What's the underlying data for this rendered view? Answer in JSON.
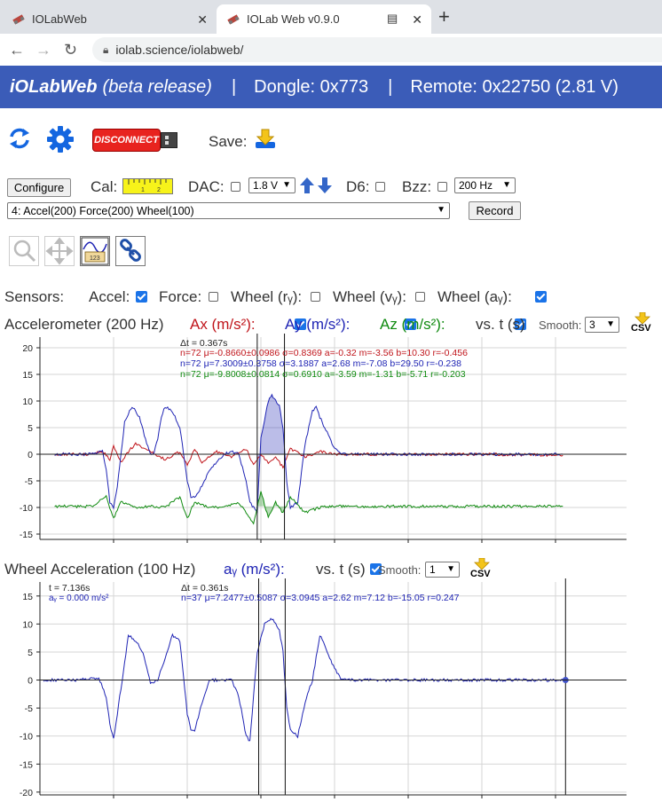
{
  "browser": {
    "tabs": [
      {
        "title": "IOLabWeb",
        "active": false
      },
      {
        "title": "IOLab Web v0.9.0",
        "active": true
      }
    ],
    "url": "iolab.science/iolabweb/"
  },
  "banner": {
    "app_name": "iOLabWeb",
    "release": "(beta release)",
    "dongle": "Dongle: 0x773",
    "remote": "Remote: 0x22750 (2.81 V)",
    "separator": "|",
    "color": "#3b5cb8"
  },
  "toolbar": {
    "disconnect_label": "DISCONNECT",
    "save_label": "Save:"
  },
  "controls": {
    "configure_label": "Configure",
    "cal_label": "Cal:",
    "dac_label": "DAC:",
    "dac_value": "1.8 V",
    "d6_label": "D6:",
    "bzz_label": "Bzz:",
    "rate_value": "200 Hz",
    "config_value": "4: Accel(200) Force(200) Wheel(100)",
    "record_label": "Record"
  },
  "sensors": {
    "label": "Sensors:",
    "items": [
      {
        "label": "Accel:",
        "checked": true
      },
      {
        "label": "Force:",
        "checked": false
      },
      {
        "label": "Wheel (rᵧ):",
        "checked": false
      },
      {
        "label": "Wheel (vᵧ):",
        "checked": false
      },
      {
        "label": "Wheel (aᵧ):",
        "checked": true
      }
    ]
  },
  "accel_panel": {
    "title": "Accelerometer (200 Hz)",
    "ax_label": "Ax (m/s²):",
    "ay_label": "Ay (m/s²):",
    "az_label": "Az (m/s²):",
    "vs_label": "vs. t (s)",
    "smooth_label": "Smooth:",
    "smooth_value": "3",
    "csv_label": "CSV",
    "dt": "Δt = 0.367s",
    "stats_ax": "n=72 μ=-0.8660±0.0986 σ=0.8369 a=-0.32 m=-3.56 b=10.30 r=-0.456",
    "stats_ay": "n=72 μ=7.3009±0.3758 σ=3.1887 a=2.68 m=-7.08 b=29.50 r=-0.238",
    "stats_az": "n=72 μ=-9.8008±0.0814 σ=0.6910 a=-3.59 m=-1.31 b=-5.71 r=-0.203",
    "colors": {
      "ax": "#c0151b",
      "ay": "#1f24b4",
      "az": "#0f8a0f"
    }
  },
  "wheel_panel": {
    "title": "Wheel Acceleration (100 Hz)",
    "ay_label": "aᵧ (m/s²):",
    "vs_label": "vs. t (s)",
    "smooth_label": "Smooth:",
    "smooth_value": "1",
    "csv_label": "CSV",
    "t_readout": "t = 7.136s",
    "ay_readout": "aᵧ = 0.000 m/s²",
    "dt": "Δt = 0.361s",
    "stats": "n=37 μ=7.2477±0.5087 σ=3.0945 a=2.62 m=7.12 b=-15.05 r=0.247"
  },
  "chart_data": [
    {
      "type": "line",
      "title": "Accelerometer (200 Hz)",
      "xlabel": "t (s)",
      "ylabel": "",
      "xlim": [
        0,
        8
      ],
      "ylim": [
        -16,
        22
      ],
      "xticks": [
        1,
        2,
        3,
        4,
        5,
        6,
        7
      ],
      "yticks": [
        -15,
        -10,
        -5,
        0,
        5,
        10,
        15,
        20
      ],
      "grid": true,
      "selection": [
        2.95,
        3.32
      ],
      "series": [
        {
          "name": "Ax (m/s²)",
          "color": "#c0151b",
          "x": [
            0.2,
            0.7,
            0.85,
            0.95,
            1.0,
            1.1,
            1.2,
            1.3,
            1.5,
            1.7,
            1.9,
            2.0,
            2.1,
            2.2,
            2.4,
            2.6,
            2.8,
            2.9,
            3.0,
            3.1,
            3.2,
            3.3,
            3.4,
            3.6,
            3.8,
            4.0,
            4.3,
            5.0,
            6.0,
            7.1
          ],
          "y": [
            0,
            0,
            0.5,
            -1,
            1.5,
            -1.5,
            0.5,
            2,
            0.5,
            -1,
            0.5,
            -2,
            1,
            -1.5,
            0.5,
            -0.5,
            1,
            -2,
            0,
            -1.5,
            -0.5,
            -2.5,
            1,
            -0.5,
            0.5,
            0,
            0,
            0,
            0,
            -0.2
          ]
        },
        {
          "name": "Ay (m/s²)",
          "color": "#1f24b4",
          "x": [
            0.2,
            0.7,
            0.85,
            0.9,
            0.95,
            1.0,
            1.05,
            1.1,
            1.15,
            1.25,
            1.35,
            1.45,
            1.5,
            1.55,
            1.6,
            1.65,
            1.7,
            1.8,
            1.9,
            2.0,
            2.05,
            2.1,
            2.2,
            2.3,
            2.5,
            2.6,
            2.7,
            2.8,
            2.85,
            2.95,
            3.0,
            3.1,
            3.15,
            3.25,
            3.3,
            3.35,
            3.4,
            3.5,
            3.6,
            3.7,
            3.75,
            3.8,
            3.9,
            4.0,
            4.1,
            4.2,
            4.3,
            4.5,
            5.0,
            6.0,
            7.1
          ],
          "y": [
            0,
            0,
            0.5,
            -3,
            -9,
            -10,
            -6,
            0,
            6,
            9,
            7,
            2,
            0,
            0.5,
            3,
            7,
            9,
            8,
            5,
            -5,
            -8,
            -8,
            -6,
            -3,
            0,
            0.5,
            0,
            -5,
            -9,
            -11,
            3,
            10,
            11,
            9,
            5,
            -5,
            -10,
            -9,
            2,
            8,
            9,
            7,
            4,
            1,
            0,
            0,
            0,
            0,
            0,
            0,
            0
          ]
        },
        {
          "name": "Az (m/s²)",
          "color": "#0f8a0f",
          "x": [
            0.2,
            0.7,
            0.9,
            1.0,
            1.1,
            1.3,
            1.5,
            1.7,
            1.9,
            2.0,
            2.1,
            2.3,
            2.5,
            2.7,
            2.9,
            3.0,
            3.1,
            3.2,
            3.3,
            3.4,
            3.6,
            3.8,
            4.0,
            4.5,
            5.0,
            6.0,
            7.1
          ],
          "y": [
            -9.8,
            -9.8,
            -8,
            -12,
            -9,
            -10,
            -9.8,
            -10,
            -8,
            -12,
            -9,
            -10,
            -10,
            -9,
            -13,
            -7,
            -12,
            -9,
            -11,
            -8,
            -11,
            -10,
            -9.8,
            -9.8,
            -9.8,
            -9.8,
            -9.8
          ]
        }
      ]
    },
    {
      "type": "line",
      "title": "Wheel Acceleration (100 Hz)",
      "xlabel": "t (s)",
      "ylabel": "",
      "xlim": [
        0,
        8
      ],
      "ylim": [
        -20.5,
        17.5
      ],
      "xticks": [
        1,
        2,
        3,
        4,
        5,
        6,
        7
      ],
      "yticks": [
        -20,
        -15,
        -10,
        -5,
        0,
        5,
        10,
        15
      ],
      "grid": true,
      "selection": [
        2.97,
        3.33
      ],
      "cursor": 7.136,
      "series": [
        {
          "name": "aᵧ (m/s²)",
          "color": "#1f24b4",
          "x": [
            0.05,
            0.5,
            0.8,
            0.9,
            0.95,
            1.0,
            1.05,
            1.15,
            1.2,
            1.3,
            1.4,
            1.5,
            1.6,
            1.7,
            1.8,
            1.9,
            2.0,
            2.05,
            2.1,
            2.2,
            2.3,
            2.5,
            2.6,
            2.7,
            2.8,
            2.85,
            2.95,
            3.05,
            3.15,
            3.25,
            3.3,
            3.35,
            3.4,
            3.5,
            3.6,
            3.7,
            3.75,
            3.8,
            3.85,
            3.9,
            4.0,
            4.1,
            4.5,
            5.0,
            6.0,
            7.136
          ],
          "y": [
            0,
            0,
            0.3,
            -3,
            -8,
            -10.5,
            -6,
            3,
            8,
            7,
            5,
            -0.5,
            0,
            4,
            8,
            7,
            -6,
            -9,
            -9,
            -4,
            0,
            0,
            0,
            -3,
            -10,
            -11,
            5,
            10,
            11,
            9,
            5,
            -5,
            -9,
            -10,
            -4,
            0,
            4,
            8,
            7,
            5,
            2,
            0,
            0,
            0,
            0,
            0
          ]
        }
      ]
    }
  ]
}
